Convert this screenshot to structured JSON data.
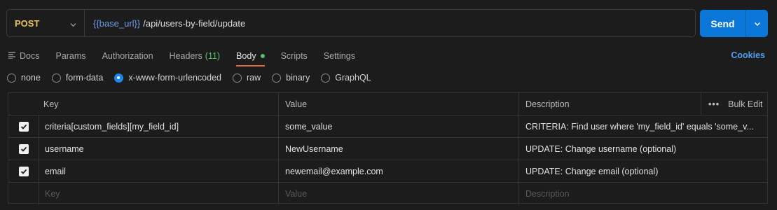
{
  "request": {
    "method": "POST",
    "url_variable": "{{base_url}}",
    "url_path": "/api/users-by-field/update",
    "send_label": "Send"
  },
  "tabs": [
    {
      "label": "Docs"
    },
    {
      "label": "Params"
    },
    {
      "label": "Authorization"
    },
    {
      "label": "Headers",
      "count": "(11)"
    },
    {
      "label": "Body"
    },
    {
      "label": "Scripts"
    },
    {
      "label": "Settings"
    }
  ],
  "cookies_label": "Cookies",
  "body_types": [
    "none",
    "form-data",
    "x-www-form-urlencoded",
    "raw",
    "binary",
    "GraphQL"
  ],
  "selected_body_type": "x-www-form-urlencoded",
  "table": {
    "headers": {
      "key": "Key",
      "value": "Value",
      "description": "Description",
      "bulk_edit": "Bulk Edit",
      "more": "•••"
    },
    "rows": [
      {
        "checked": true,
        "key": "criteria[custom_fields][my_field_id]",
        "value": "some_value",
        "description": "CRITERIA: Find user where 'my_field_id' equals 'some_v..."
      },
      {
        "checked": true,
        "key": "username",
        "value": "NewUsername",
        "description": "UPDATE: Change username (optional)"
      },
      {
        "checked": true,
        "key": "email",
        "value": "newemail@example.com",
        "description": "UPDATE: Change email (optional)"
      }
    ],
    "placeholders": {
      "key": "Key",
      "value": "Value",
      "description": "Description"
    }
  },
  "colors": {
    "background": "#1c1c1c",
    "method": "#e8c45a",
    "url_variable": "#6d9be8",
    "send": "#0b78d9",
    "active_tab_underline": "#e46b3c",
    "headers_count": "#5bbf6a",
    "link": "#4e9ef0",
    "radio_selected": "#1e86f0"
  }
}
